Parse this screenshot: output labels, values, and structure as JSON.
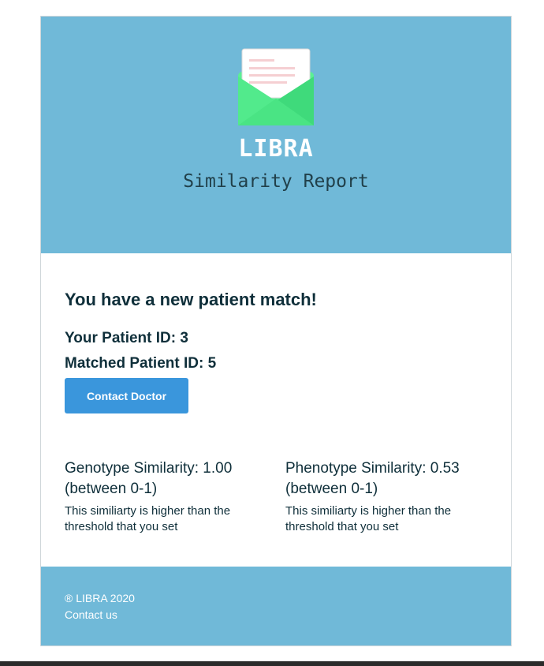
{
  "header": {
    "brand": "LIBRA",
    "subtitle": "Similarity Report",
    "envelope_icon": "envelope-letter-icon",
    "background_color": "#70b9d8"
  },
  "main": {
    "headline": "You have a new patient match!",
    "your_patient_id": "Your Patient ID: 3",
    "matched_patient_id": "Matched Patient ID: 5",
    "contact_button_label": "Contact Doctor",
    "button_color": "#3a96dc"
  },
  "similarities": [
    {
      "title_line1": "Genotype Similarity: 1.00",
      "title_line2": "(between 0-1)",
      "note": "This similiarty is higher than the threshold that you set"
    },
    {
      "title_line1": "Phenotype Similarity: 0.53",
      "title_line2": "(between 0-1)",
      "note": "This similiarty is higher than the threshold that you set"
    }
  ],
  "footer": {
    "copyright": "® LIBRA 2020",
    "contact_link": "Contact us"
  }
}
